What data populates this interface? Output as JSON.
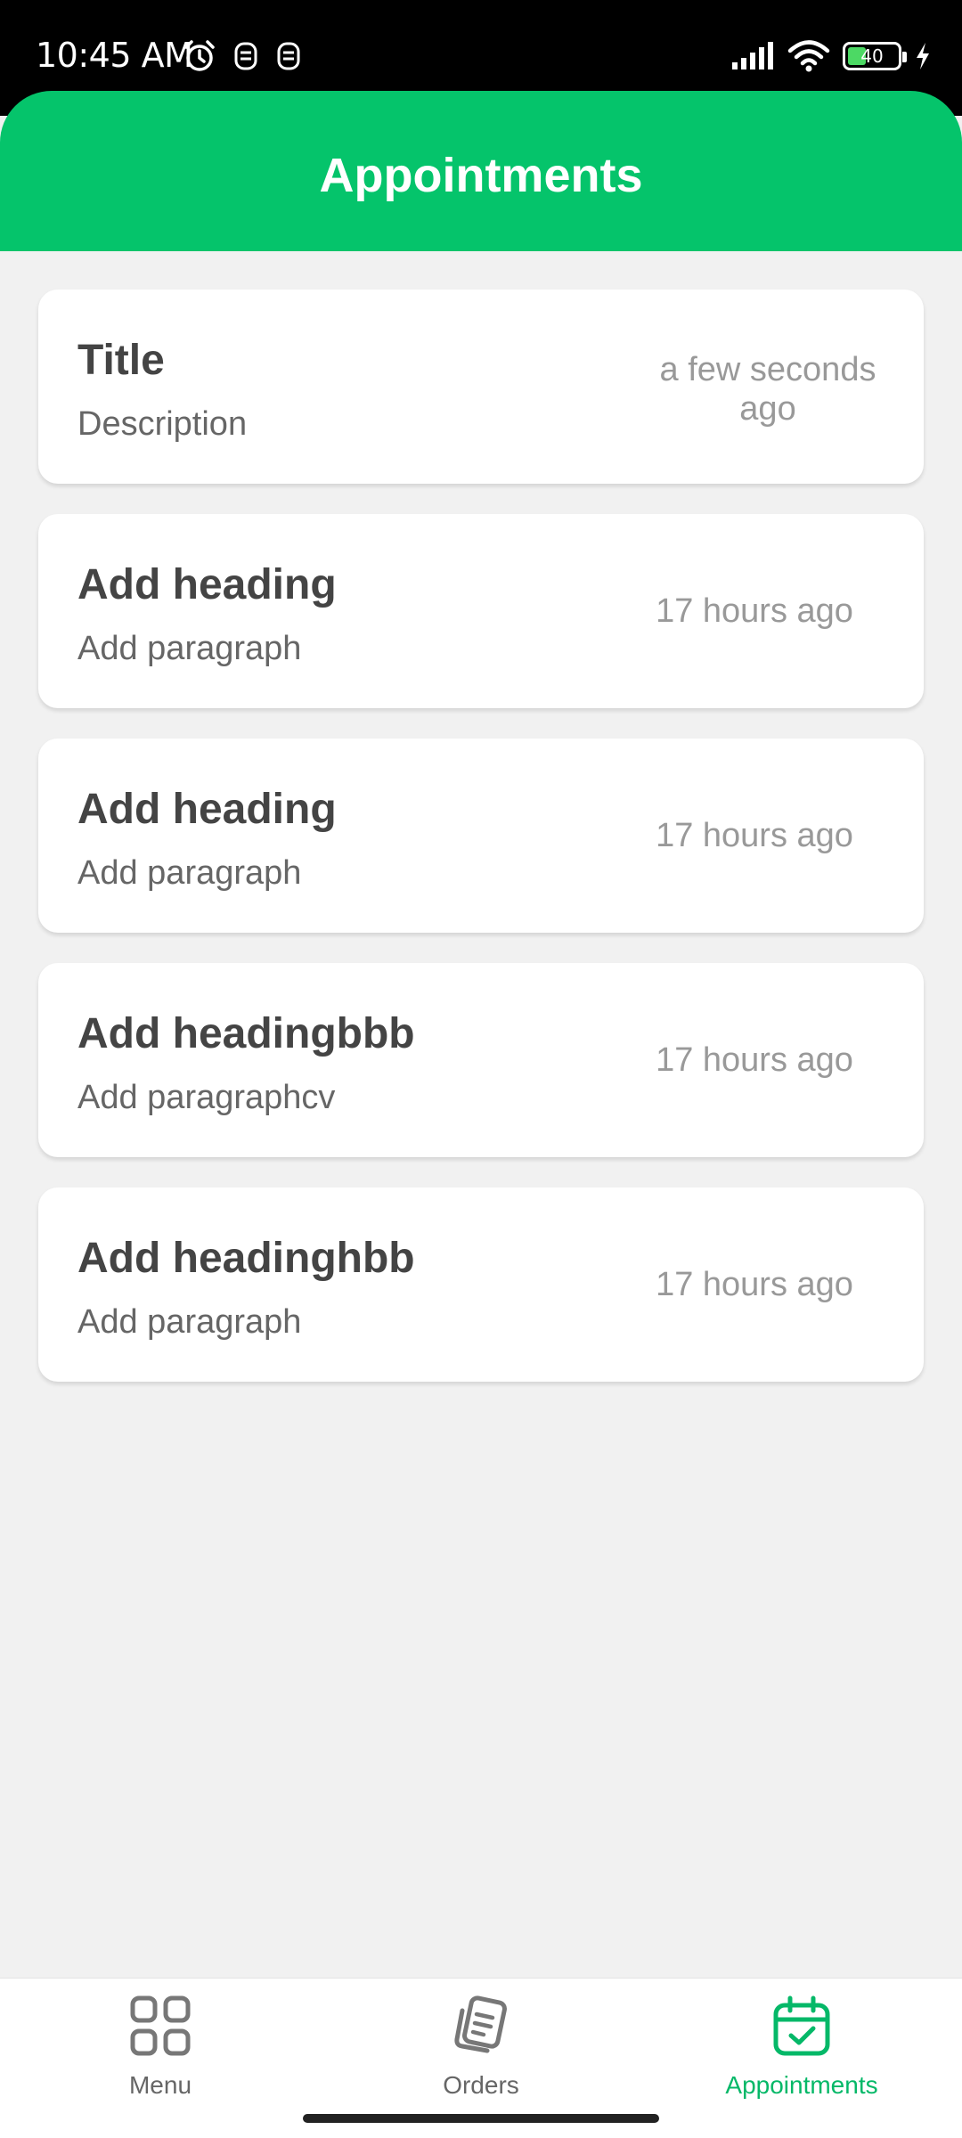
{
  "status_bar": {
    "time": "10:45 AM",
    "battery": "40",
    "icons": [
      "alarm-icon",
      "app-notification-icon",
      "app-notification-icon",
      "signal-icon",
      "wifi-icon",
      "battery-icon",
      "charging-icon"
    ]
  },
  "header": {
    "title": "Appointments"
  },
  "appointments": [
    {
      "title": "Title",
      "description": "Description",
      "time": "a few seconds ago"
    },
    {
      "title": "Add heading",
      "description": "Add paragraph",
      "time": "17 hours ago"
    },
    {
      "title": "Add heading",
      "description": "Add paragraph",
      "time": "17 hours ago"
    },
    {
      "title": "Add headingbbb",
      "description": "Add paragraphcv",
      "time": "17 hours ago"
    },
    {
      "title": "Add headinghbb",
      "description": "Add paragraph",
      "time": "17 hours ago"
    }
  ],
  "bottom_nav": {
    "items": [
      {
        "label": "Menu",
        "icon": "grid-icon",
        "active": false
      },
      {
        "label": "Orders",
        "icon": "orders-icon",
        "active": false
      },
      {
        "label": "Appointments",
        "icon": "calendar-check-icon",
        "active": true
      }
    ]
  },
  "colors": {
    "accent": "#05c46b",
    "background": "#f1f1f1",
    "active_nav": "#05b868"
  }
}
